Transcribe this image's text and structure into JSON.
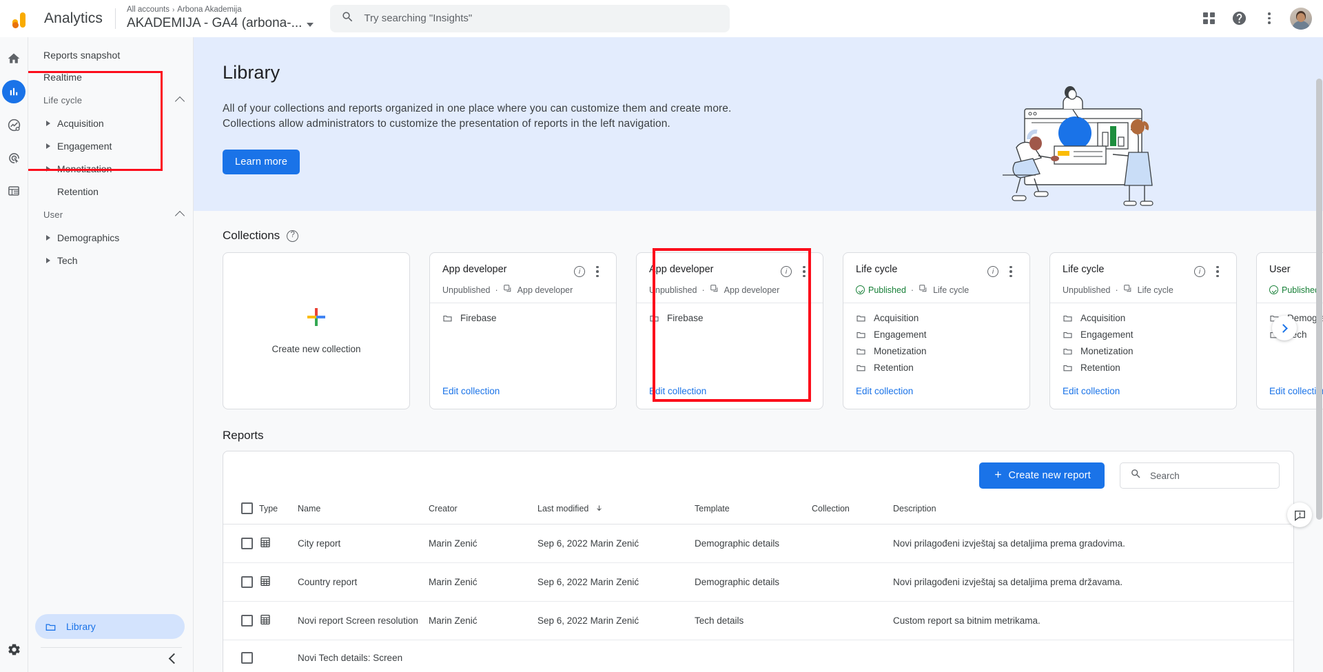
{
  "topbar": {
    "brand": "Analytics",
    "breadcrumb_root": "All accounts",
    "breadcrumb_sep": "›",
    "breadcrumb_account": "Arbona Akademija",
    "property_name": "AKADEMIJA - GA4 (arbona-...",
    "search_placeholder": "Try searching \"Insights\"",
    "search_value": "",
    "icons": {
      "apps": "apps-grid-icon",
      "help": "help-icon",
      "more": "more-vert-icon",
      "avatar": "user-avatar"
    }
  },
  "rail": {
    "items": [
      {
        "name": "home-icon",
        "label": "Home",
        "active": false
      },
      {
        "name": "reports-bar-chart-icon",
        "label": "Reports",
        "active": true
      },
      {
        "name": "explore-icon",
        "label": "Explore",
        "active": false
      },
      {
        "name": "advertising-icon",
        "label": "Advertising",
        "active": false
      },
      {
        "name": "configure-table-icon",
        "label": "Configure",
        "active": false
      }
    ],
    "bottom": {
      "name": "settings-gear-icon",
      "label": "Admin"
    }
  },
  "sidebar": {
    "links": [
      {
        "label": "Reports snapshot"
      },
      {
        "label": "Realtime"
      }
    ],
    "groups": [
      {
        "title": "Life cycle",
        "highlighted": true,
        "items": [
          {
            "label": "Acquisition",
            "expandable": true
          },
          {
            "label": "Engagement",
            "expandable": true
          },
          {
            "label": "Monetization",
            "expandable": true
          },
          {
            "label": "Retention",
            "expandable": false
          }
        ]
      },
      {
        "title": "User",
        "highlighted": false,
        "items": [
          {
            "label": "Demographics",
            "expandable": true
          },
          {
            "label": "Tech",
            "expandable": true
          }
        ]
      }
    ],
    "library": {
      "label": "Library",
      "icon": "folder-icon",
      "selected": true
    },
    "collapse": {
      "name": "collapse-chevron-left-icon"
    }
  },
  "hero": {
    "title": "Library",
    "description": "All of your collections and reports organized in one place where you can customize them and create more. Collections allow administrators to customize the presentation of reports in the left navigation.",
    "cta": "Learn more",
    "illustration": "library-people-dashboard-illustration"
  },
  "collections": {
    "heading": "Collections",
    "help_icon": "help-circle-icon",
    "create_card": {
      "label": "Create new collection",
      "icon": "plus-multicolor-icon"
    },
    "edit_link": "Edit collection",
    "next_button": "carousel-next-icon",
    "highlight_color": "#fc0d1b",
    "items": [
      {
        "title": "App developer",
        "status": "Unpublished",
        "published": false,
        "template": "App developer",
        "folders": [
          "Firebase"
        ],
        "highlighted": false
      },
      {
        "title": "App developer",
        "status": "Unpublished",
        "published": false,
        "template": "App developer",
        "folders": [
          "Firebase"
        ],
        "highlighted": false
      },
      {
        "title": "Life cycle",
        "status": "Published",
        "published": true,
        "template": "Life cycle",
        "folders": [
          "Acquisition",
          "Engagement",
          "Monetization",
          "Retention"
        ],
        "highlighted": true
      },
      {
        "title": "Life cycle",
        "status": "Unpublished",
        "published": false,
        "template": "Life cycle",
        "folders": [
          "Acquisition",
          "Engagement",
          "Monetization",
          "Retention"
        ],
        "highlighted": false
      },
      {
        "title": "User",
        "status": "Published",
        "published": true,
        "template": "",
        "folders": [
          "Demographics",
          "Tech"
        ],
        "highlighted": false
      }
    ]
  },
  "reports": {
    "heading": "Reports",
    "create_button": "Create new report",
    "search_placeholder": "Search",
    "search_value": "",
    "columns": [
      "Type",
      "Name",
      "Creator",
      "Last modified",
      "Template",
      "Collection",
      "Description"
    ],
    "sorted_column": "Last modified",
    "sort_direction": "descending",
    "rows": [
      {
        "type_icon": "table-report-icon",
        "name": "City report",
        "creator": "Marin Zenić",
        "last_modified": "Sep 6, 2022 Marin Zenić",
        "template": "Demographic details",
        "collection": "",
        "description": "Novi prilagođeni izvještaj sa detaljima prema gradovima."
      },
      {
        "type_icon": "table-report-icon",
        "name": "Country report",
        "creator": "Marin Zenić",
        "last_modified": "Sep 6, 2022 Marin Zenić",
        "template": "Demographic details",
        "collection": "",
        "description": "Novi prilagođeni izvještaj sa detaljima prema državama."
      },
      {
        "type_icon": "table-report-icon",
        "name": "Novi report Screen resolution",
        "creator": "Marin Zenić",
        "last_modified": "Sep 6, 2022 Marin Zenić",
        "template": "Tech details",
        "collection": "",
        "description": "Custom report sa bitnim metrikama."
      },
      {
        "type_icon": "table-report-icon",
        "name": "Novi Tech details: Screen",
        "creator": "",
        "last_modified": "",
        "template": "",
        "collection": "",
        "description": ""
      }
    ]
  },
  "feedback": {
    "icon": "feedback-icon"
  }
}
